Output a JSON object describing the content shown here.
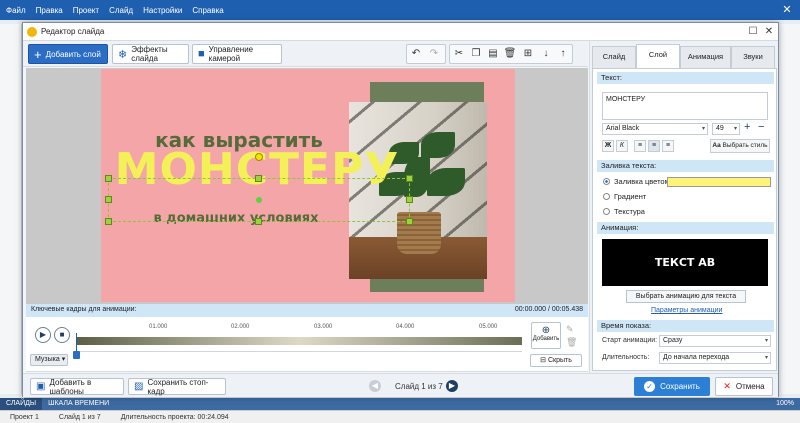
{
  "menu": [
    "Файл",
    "Правка",
    "Проект",
    "Слайд",
    "Настройки",
    "Справка"
  ],
  "dialog": {
    "title": "Редактор слайда",
    "toolbar": {
      "add_layer": "Добавить слой",
      "effects": "Эффекты слайда",
      "camera": "Управление камерой"
    },
    "slide": {
      "line1": "как вырастить",
      "line2": "МОНСТЕРУ",
      "line3": "в домашних условиях",
      "bg_color": "#f3a5a8",
      "text_yellow": "#f4f058",
      "text_green": "#556b3a"
    },
    "keyframes": {
      "title": "Ключевые кадры для анимации:",
      "time": "00:00.000 / 00:05.438",
      "ticks": [
        "01.000",
        "02.000",
        "03.000",
        "04.000",
        "05.000"
      ],
      "add_label": "Добавить",
      "music_label": "Музыка",
      "hide_label": "Скрыть"
    },
    "bottom": {
      "templates": "Добавить в шаблоны",
      "stopframe": "Сохранить стоп-кадр",
      "slide_nav": "Слайд 1 из 7",
      "save": "Сохранить",
      "cancel": "Отмена"
    },
    "panel": {
      "tabs": [
        "Слайд",
        "Слой",
        "Анимация",
        "Звуки"
      ],
      "active_tab": "Слой",
      "text_header": "Текст:",
      "text_value": "МОНСТЕРУ",
      "font": "Arial Black",
      "font_size": "49",
      "fmt_bold": "Ж",
      "fmt_italic": "К",
      "choose_style": "Выбрать стиль",
      "fill_header": "Заливка текста:",
      "fill_color": "Заливка цветом",
      "fill_gradient": "Градиент",
      "fill_texture": "Текстура",
      "fill_swatch": "#fff47a",
      "anim_header": "Анимация:",
      "anim_preview": "ТЕКСТ АВ",
      "choose_anim": "Выбрать анимацию для текста",
      "anim_params": "Параметры анимации",
      "time_header": "Время показа:",
      "start_label": "Старт анимации:",
      "start_value": "Сразу",
      "duration_label": "Длительность:",
      "duration_value": "До начала перехода"
    }
  },
  "statusbar": {
    "tab_slides": "СЛАЙДЫ",
    "tab_timeline": "ШКАЛА ВРЕМЕНИ",
    "zoom": "100%",
    "project": "Проект 1",
    "slide": "Слайд 1 из 7",
    "duration": "Длительность проекта: 00:24.094"
  }
}
